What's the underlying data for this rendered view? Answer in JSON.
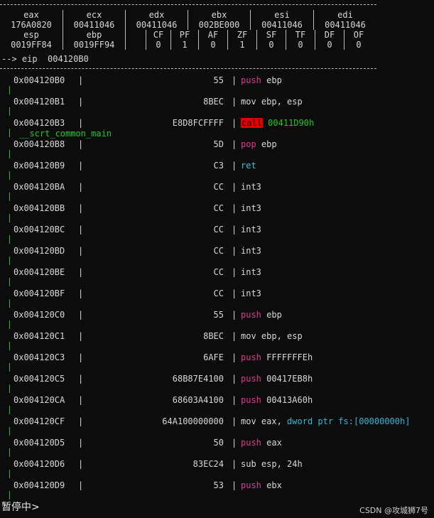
{
  "registers": {
    "row1_names": [
      "eax",
      "ecx",
      "edx",
      "ebx",
      "esi",
      "edi"
    ],
    "row1_values": [
      "176A0820",
      "00411046",
      "00411046",
      "002BE000",
      "00411046",
      "00411046"
    ],
    "row2_names": [
      "esp",
      "ebp",
      "CF",
      "PF",
      "AF",
      "ZF",
      "SF",
      "TF",
      "DF",
      "OF"
    ],
    "row2_values": [
      "0019FF84",
      "0019FF94",
      "0",
      "1",
      "0",
      "1",
      "0",
      "0",
      "0",
      "0"
    ],
    "eip_line": "--> eip  004120B0"
  },
  "symbol": "__scrt_common_main",
  "rows": [
    {
      "addr": "0x004120B0",
      "bytes": "55",
      "mn": "push",
      "mn_class": "mn-push",
      "op": "ebp",
      "op_class": "op-plain"
    },
    {
      "addr": "0x004120B1",
      "bytes": "8BEC",
      "mn": "mov",
      "mn_class": "mn-plain",
      "op": "ebp, esp",
      "op_class": "op-plain"
    },
    {
      "addr": "0x004120B3",
      "bytes": "E8D8FCFFFF",
      "mn": "call",
      "mn_class": "mn-call",
      "op": "00411D90h",
      "op_class": "op-green"
    },
    {
      "addr": "0x004120B8",
      "bytes": "5D",
      "mn": "pop",
      "mn_class": "mn-push",
      "op": "ebp",
      "op_class": "op-plain"
    },
    {
      "addr": "0x004120B9",
      "bytes": "C3",
      "mn": "ret",
      "mn_class": "mn-ret",
      "op": "",
      "op_class": "op-plain"
    },
    {
      "addr": "0x004120BA",
      "bytes": "CC",
      "mn": "int3",
      "mn_class": "mn-plain",
      "op": "",
      "op_class": "op-plain"
    },
    {
      "addr": "0x004120BB",
      "bytes": "CC",
      "mn": "int3",
      "mn_class": "mn-plain",
      "op": "",
      "op_class": "op-plain"
    },
    {
      "addr": "0x004120BC",
      "bytes": "CC",
      "mn": "int3",
      "mn_class": "mn-plain",
      "op": "",
      "op_class": "op-plain"
    },
    {
      "addr": "0x004120BD",
      "bytes": "CC",
      "mn": "int3",
      "mn_class": "mn-plain",
      "op": "",
      "op_class": "op-plain"
    },
    {
      "addr": "0x004120BE",
      "bytes": "CC",
      "mn": "int3",
      "mn_class": "mn-plain",
      "op": "",
      "op_class": "op-plain"
    },
    {
      "addr": "0x004120BF",
      "bytes": "CC",
      "mn": "int3",
      "mn_class": "mn-plain",
      "op": "",
      "op_class": "op-plain"
    },
    {
      "addr": "0x004120C0",
      "bytes": "55",
      "mn": "push",
      "mn_class": "mn-push",
      "op": "ebp",
      "op_class": "op-plain"
    },
    {
      "addr": "0x004120C1",
      "bytes": "8BEC",
      "mn": "mov",
      "mn_class": "mn-plain",
      "op": "ebp, esp",
      "op_class": "op-plain"
    },
    {
      "addr": "0x004120C3",
      "bytes": "6AFE",
      "mn": "push",
      "mn_class": "mn-push",
      "op": "FFFFFFFEh",
      "op_class": "op-plain"
    },
    {
      "addr": "0x004120C5",
      "bytes": "68B87E4100",
      "mn": "push",
      "mn_class": "mn-push",
      "op": "00417EB8h",
      "op_class": "op-plain"
    },
    {
      "addr": "0x004120CA",
      "bytes": "68603A4100",
      "mn": "push",
      "mn_class": "mn-push",
      "op": "00413A60h",
      "op_class": "op-plain"
    },
    {
      "addr": "0x004120CF",
      "bytes": "64A100000000",
      "mn": "mov",
      "mn_class": "mn-plain",
      "op": "eax, ",
      "op_class": "op-plain",
      "op2": "dword ptr fs:[00000000h]",
      "op2_class": "op-cyan"
    },
    {
      "addr": "0x004120D5",
      "bytes": "50",
      "mn": "push",
      "mn_class": "mn-push",
      "op": "eax",
      "op_class": "op-plain"
    },
    {
      "addr": "0x004120D6",
      "bytes": "83EC24",
      "mn": "sub",
      "mn_class": "mn-plain",
      "op": "esp, 24h",
      "op_class": "op-plain"
    },
    {
      "addr": "0x004120D9",
      "bytes": "53",
      "mn": "push",
      "mn_class": "mn-push",
      "op": "ebx",
      "op_class": "op-plain"
    }
  ],
  "status": "暂停中>",
  "watermark": "CSDN @攻城狮7号",
  "colors": {
    "background": "#0c0c0c",
    "push": "#e0398f",
    "call_bg": "#e00000",
    "green": "#20c820",
    "cyan": "#33b8d6"
  }
}
